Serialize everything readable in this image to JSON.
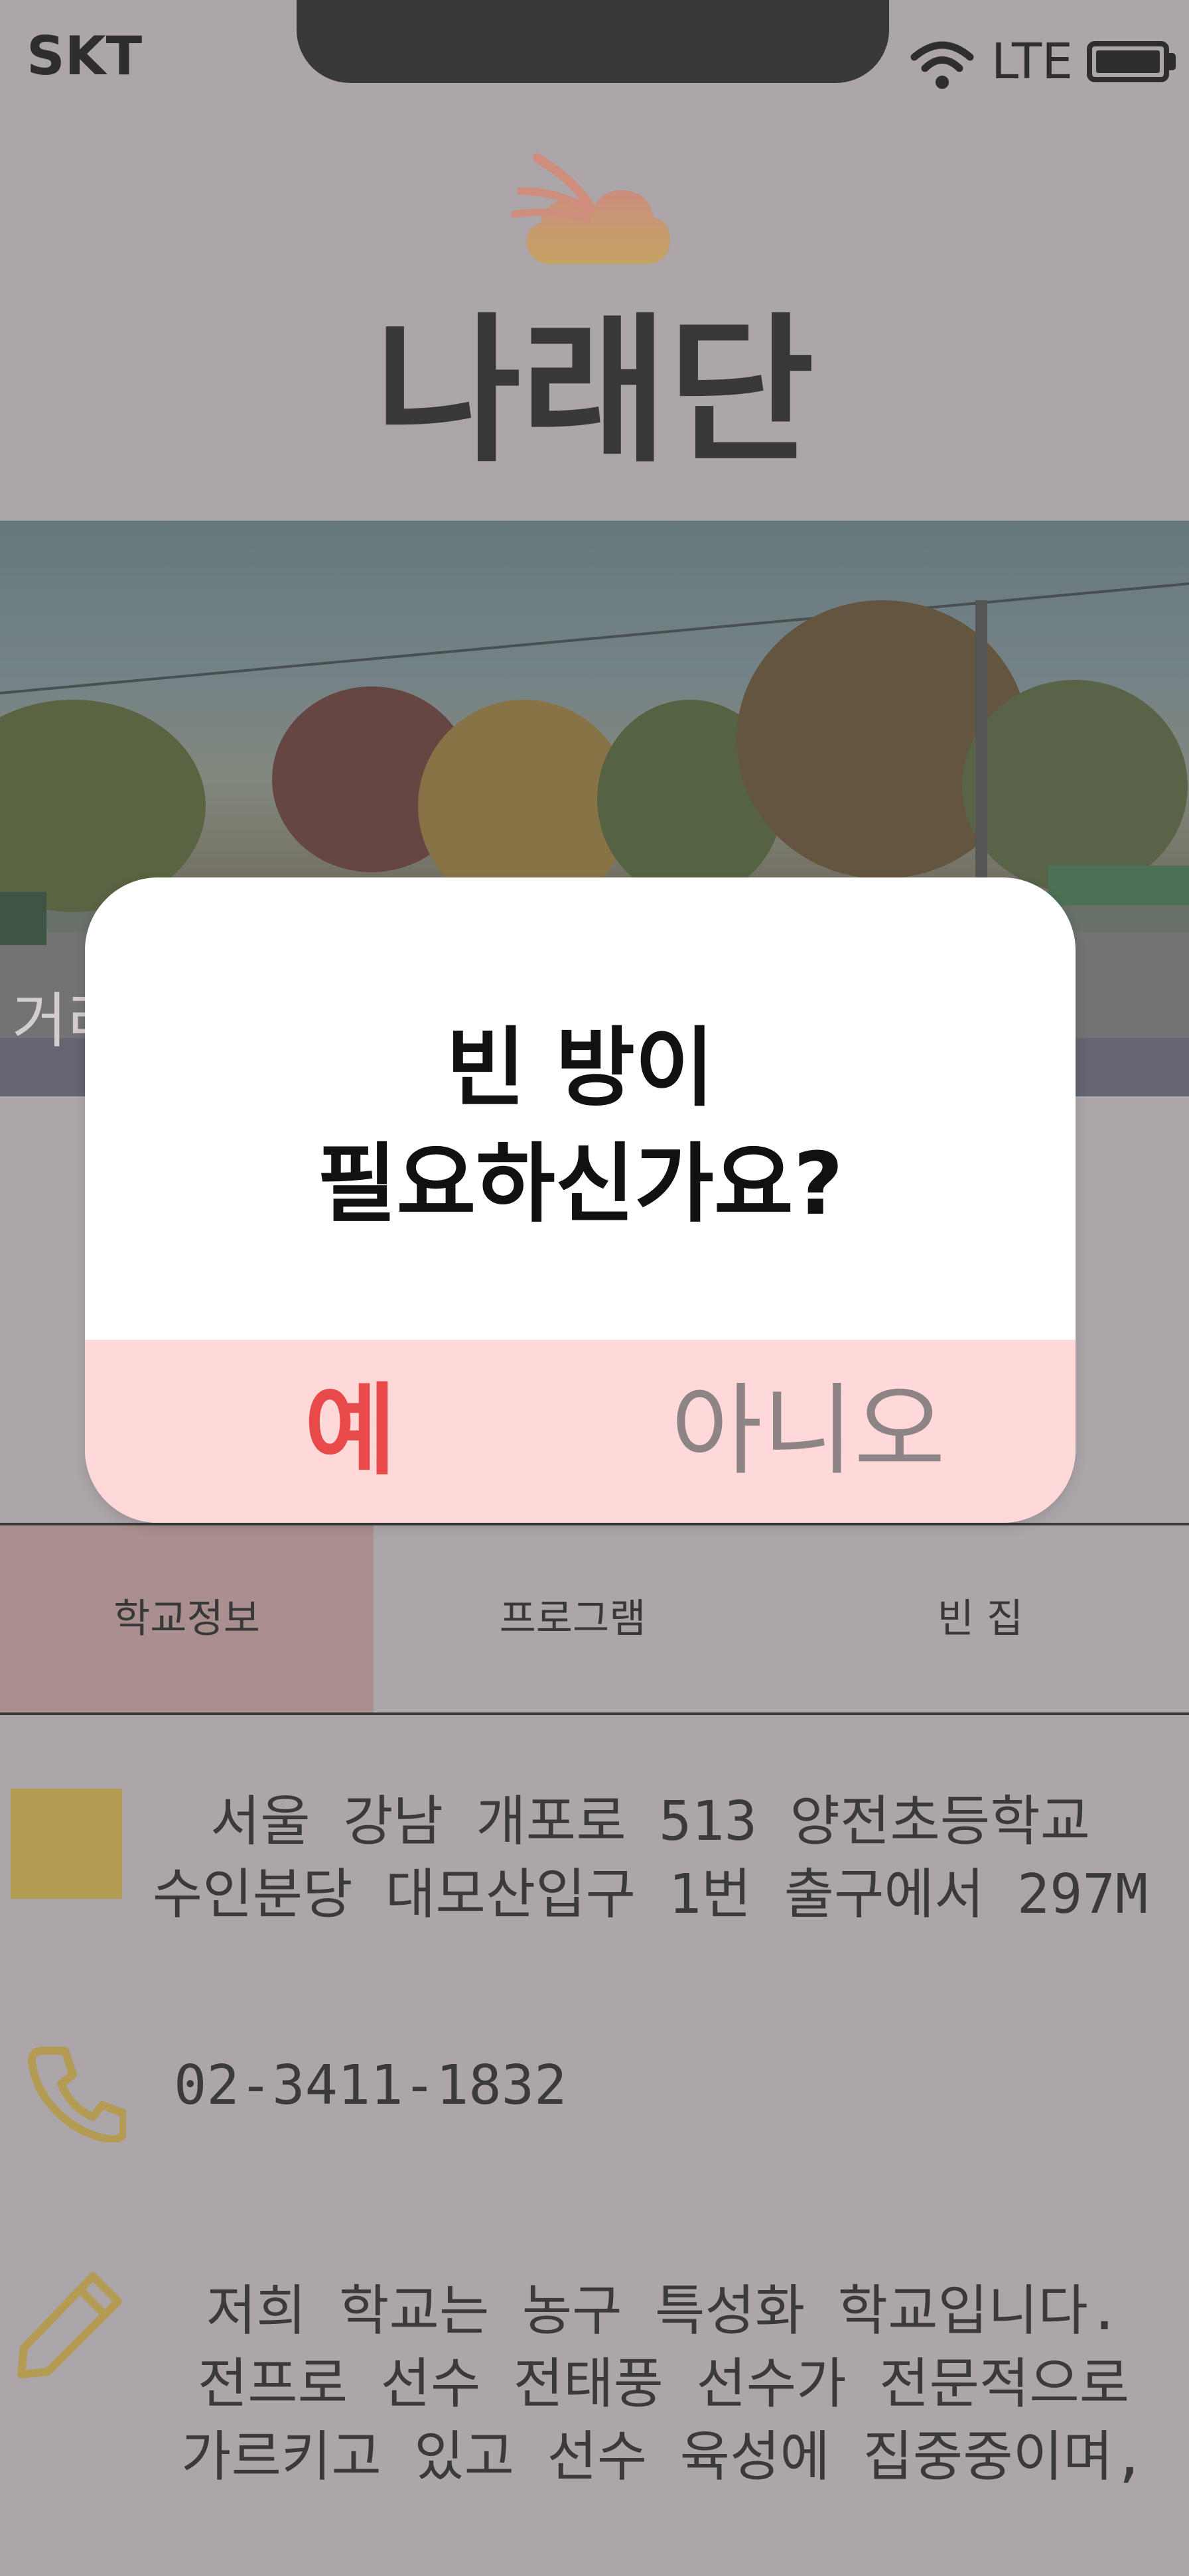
{
  "status_bar": {
    "carrier": "SKT",
    "network": "LTE",
    "icons": [
      "wifi-icon",
      "battery-icon"
    ]
  },
  "header": {
    "logo_icon": "cloud-bird-logo",
    "title": "나래단"
  },
  "banner": {
    "caption": "거리"
  },
  "dialog": {
    "message_line1": "빈 방이",
    "message_line2": "필요하신가요?",
    "yes_label": "예",
    "no_label": "아니오"
  },
  "tabs": [
    {
      "label": "학교정보",
      "selected": true
    },
    {
      "label": "프로그램",
      "selected": false
    },
    {
      "label": "빈 집",
      "selected": false
    }
  ],
  "info": {
    "address_line1": "서울 강남 개포로 513 양전초등학교",
    "address_line2": "수인분당 대모산입구 1번 출구에서 297M",
    "phone": "02-3411-1832",
    "description_lines": [
      "저희 학교는 농구 특성화 학교입니다.",
      "전프로 선수 전태풍 선수가 전문적으로",
      "가르키고 있고 선수 육성에 집중중이며,"
    ]
  },
  "colors": {
    "background": "#aca6aa",
    "accent_gold": "#b59a48",
    "yes_red": "#e84a4a",
    "dialog_action_bg": "#ffd9d9",
    "tab_selected_bg": "#a98c8b"
  }
}
